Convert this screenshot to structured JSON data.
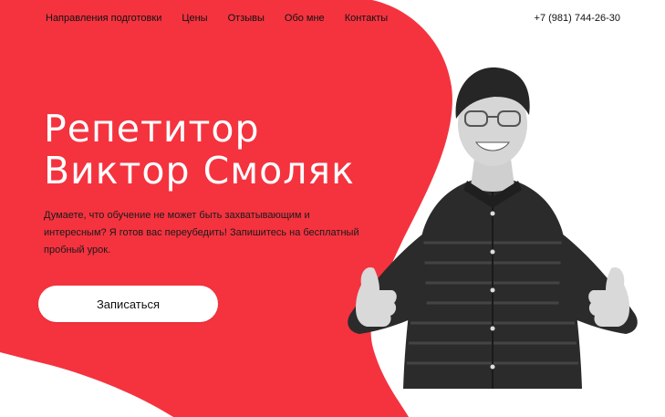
{
  "nav": {
    "items": [
      {
        "label": "Направления подготовки"
      },
      {
        "label": "Цены"
      },
      {
        "label": "Отзывы"
      },
      {
        "label": "Обо мне"
      },
      {
        "label": "Контакты"
      }
    ],
    "phone": "+7 (981) 744-26-30"
  },
  "hero": {
    "title_line1": "Репетитор",
    "title_line2": "Виктор Смоляк",
    "description": "Думаете, что обучение не может быть захватывающим и интересным? Я готов вас переубедить! Запишитесь на бесплатный пробный урок.",
    "cta_label": "Записаться"
  },
  "colors": {
    "accent": "#f4333f",
    "background": "#ffffff",
    "text": "#111111"
  },
  "icons": {
    "photo": "tutor-portrait"
  }
}
